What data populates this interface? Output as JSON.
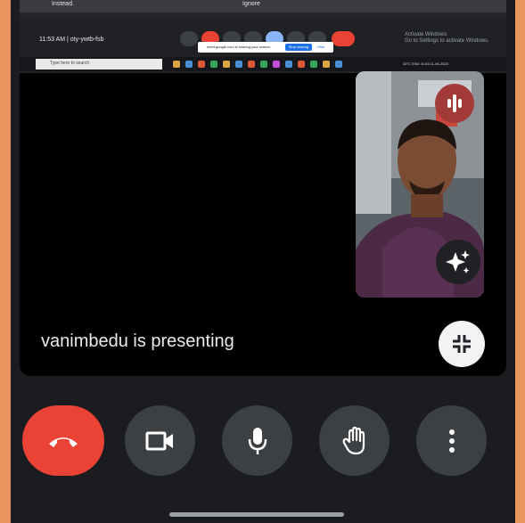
{
  "shared_screen": {
    "top_left_text": "Instead.",
    "top_center_text": "Ignore",
    "meeting_time": "11:53 AM",
    "meeting_code": "oty-ywtb-fsb",
    "sharing_banner": {
      "text": "meet.google.com is sharing your screen.",
      "stop_label": "Stop sharing",
      "hide_label": "Hide"
    },
    "activate_text": "Activate Windows\nGo to Settings to activate Windows.",
    "search_placeholder": "Type here to search",
    "tray_text": "33°C  ENG  11:53  11-06-2023"
  },
  "stage": {
    "presenting_text": "vanimbedu is presenting"
  },
  "participant_tile": {
    "mic_indicator": "speaking-indicator-icon",
    "effects_button": "sparkle-icon"
  },
  "collapse_button": "collapse-icon",
  "controls": [
    {
      "name": "end-call-button",
      "icon": "phone-hangup-icon"
    },
    {
      "name": "camera-button",
      "icon": "video-camera-icon"
    },
    {
      "name": "microphone-button",
      "icon": "microphone-icon"
    },
    {
      "name": "raise-hand-button",
      "icon": "hand-icon"
    },
    {
      "name": "more-options-button",
      "icon": "more-vertical-icon"
    }
  ],
  "colors": {
    "background": "#1b1c1f",
    "end_call": "#ea4335",
    "control": "#3c4043",
    "speaking": "#a23a37",
    "outer_border": "#e8955f"
  }
}
